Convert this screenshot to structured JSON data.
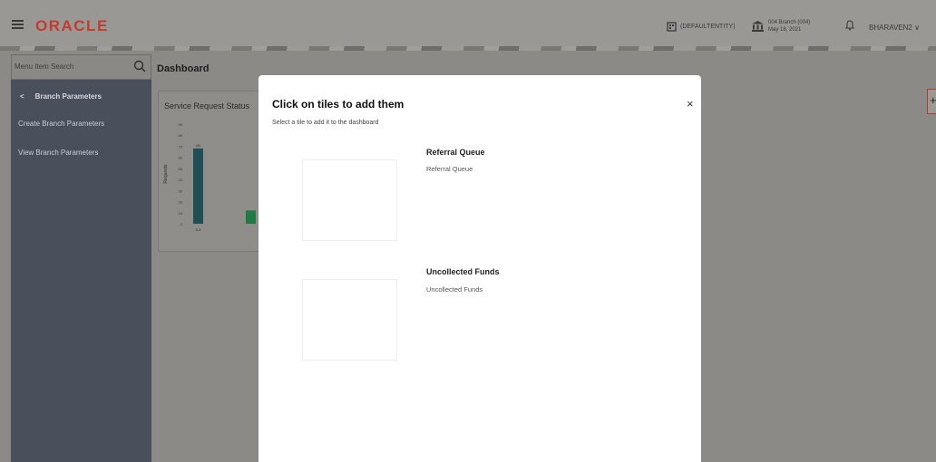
{
  "header": {
    "logo": "ORACLE",
    "entity": "(DEFAULTENTITY)",
    "branch_line1": "004 Branch (004)",
    "branch_line2": "May 18, 2021",
    "user": "BHARAVEN2 ∨"
  },
  "sidebar": {
    "search_placeholder": "Menu Item Search",
    "back_label": "Branch Parameters",
    "items": [
      {
        "label": "Create Branch Parameters"
      },
      {
        "label": "View Branch Parameters"
      }
    ]
  },
  "main": {
    "title": "Dashboard",
    "card_title": "Service Request Status"
  },
  "chart_data": {
    "type": "bar",
    "ylabel": "Requests",
    "categories": [
      "0-3",
      ""
    ],
    "values": [
      68,
      12
    ],
    "value_labels": [
      "68",
      ""
    ],
    "ylim": [
      0,
      90
    ],
    "yticks": [
      "90",
      "80",
      "70",
      "60",
      "50",
      "40",
      "30",
      "20",
      "10",
      "0"
    ],
    "colors": [
      "#1f4e57",
      "#1f7a44"
    ]
  },
  "modal": {
    "title": "Click on tiles to add them",
    "subtitle": "Select a tile to add it to the dashboard",
    "close": "×",
    "tiles": [
      {
        "name": "Referral Queue",
        "desc": "Referral Queue"
      },
      {
        "name": "Uncollected Funds",
        "desc": "Uncollected Funds"
      }
    ]
  },
  "add_button": "+"
}
